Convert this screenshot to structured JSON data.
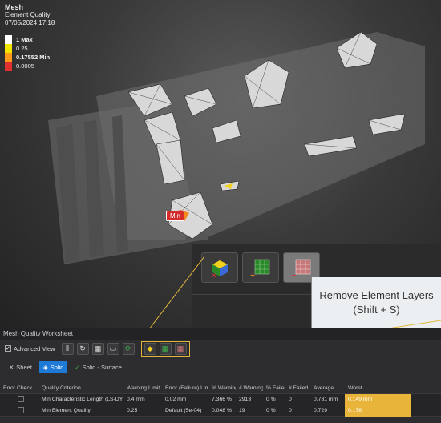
{
  "header": {
    "title": "Mesh",
    "subtitle": "Element Quality",
    "timestamp": "07/05/2024 17:18"
  },
  "legend": [
    {
      "label": "1 Max",
      "color": "#ffffff",
      "bold": true
    },
    {
      "label": "0.25",
      "color": "#f2e600",
      "bold": false
    },
    {
      "label": "0.17552 Min",
      "color": "#ff9a1a",
      "bold": true
    },
    {
      "label": "0.0005",
      "color": "#e03030",
      "bold": false
    }
  ],
  "min_tag": "Min",
  "tooltip": {
    "title": "Remove Element Layers",
    "shortcut": "(Shift + S)"
  },
  "panel": {
    "title": "Mesh Quality Worksheet",
    "advanced_view": "Advanced View",
    "tabs": [
      {
        "label": "Sheet",
        "icon": "close-icon"
      },
      {
        "label": "Solid",
        "icon": "solid-icon"
      },
      {
        "label": "Solid - Surface",
        "icon": "check-icon"
      }
    ],
    "columns": [
      "Error Check",
      "Quality Criterion",
      "Warning Limit",
      "Error (Failure) Limit",
      "% Warning",
      "# Warning",
      "% Failed",
      "# Failed",
      "Average",
      "Worst"
    ],
    "rows": [
      [
        "",
        "Min Characteristic Length (LS-DYNA)",
        "0.4 mm",
        "0.02 mm",
        "7.366 %",
        "2913",
        "0 %",
        "0",
        "0.781 mm",
        "0.149 mm"
      ],
      [
        "",
        "Min Element Quality",
        "0.25",
        "Default (5e-04)",
        "0.048 %",
        "19",
        "0 %",
        "0",
        "0.729",
        "0.176"
      ]
    ]
  },
  "colors": {
    "accent": "#1e7ad6",
    "highlight": "#e0b63b",
    "worst": "#e8b43a"
  }
}
